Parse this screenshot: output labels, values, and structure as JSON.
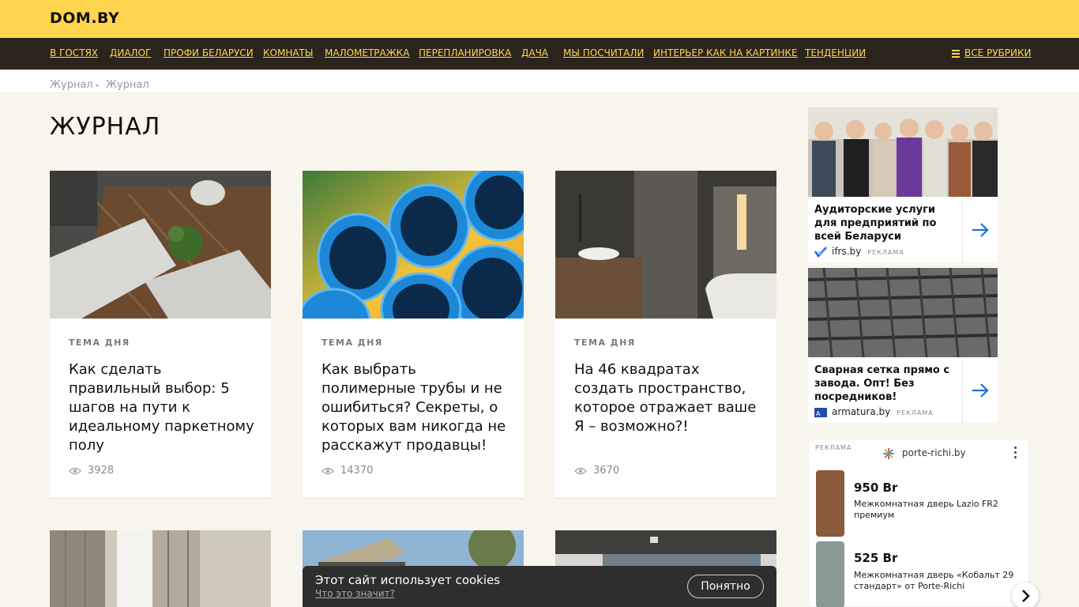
{
  "header": {
    "logo": "DOM.BY"
  },
  "nav": {
    "items": [
      "В ГОСТЯХ",
      "ДИАЛОГ",
      "ПРОФИ БЕЛАРУСИ",
      "КОМНАТЫ",
      "МАЛОМЕТРАЖКА",
      "ПЕРЕПЛАНИРОВКА",
      "ДАЧА",
      "МЫ ПОСЧИТАЛИ",
      "ИНТЕРЬЕР КАК НА КАРТИНКЕ",
      "ТЕНДЕНЦИИ"
    ],
    "all_rubrics": "ВСЕ РУБРИКИ"
  },
  "breadcrumb": [
    "Журнал",
    "Журнал"
  ],
  "page": {
    "title": "ЖУРНАЛ"
  },
  "cards": [
    {
      "tag": "ТЕМА ДНЯ",
      "title": "Как сделать правильный выбор: 5 шагов на пути к идеальному паркетному полу",
      "views": "3928"
    },
    {
      "tag": "ТЕМА ДНЯ",
      "title": "Как выбрать полимерные трубы и не ошибиться? Секреты, о которых вам никогда не расскажут продавцы!",
      "views": "14370"
    },
    {
      "tag": "ТЕМА ДНЯ",
      "title": "На 46 квадратах создать пространство, которое отражает ваше Я – возможно?!",
      "views": "3670"
    }
  ],
  "ads": [
    {
      "text": "Аудиторские услуги для предприятий по всей Беларуси",
      "site": "ifrs.by",
      "label": "РЕКЛАМА"
    },
    {
      "text": "Сварная сетка прямо с завода. Опт! Без посредников!",
      "site": "armatura.by",
      "label": "РЕКЛАМА"
    }
  ],
  "product_ad": {
    "label": "РЕКЛАМА",
    "site": "porte-richi.by",
    "products": [
      {
        "price": "950 Br",
        "name": "Межкомнатная дверь Lazio FR2 премиум"
      },
      {
        "price": "525 Br",
        "name": "Межкомнатная дверь «Кобальт 29 стандарт» от Porte-Richi"
      }
    ]
  },
  "cookie": {
    "text": "Этот сайт использует cookies",
    "link": "Что это значит?",
    "button": "Понятно"
  },
  "colors": {
    "brand_yellow": "#ffd54f",
    "nav_dark": "#2a241c",
    "page_bg": "#f8f5ec",
    "ad_arrow": "#1e6fd9"
  }
}
